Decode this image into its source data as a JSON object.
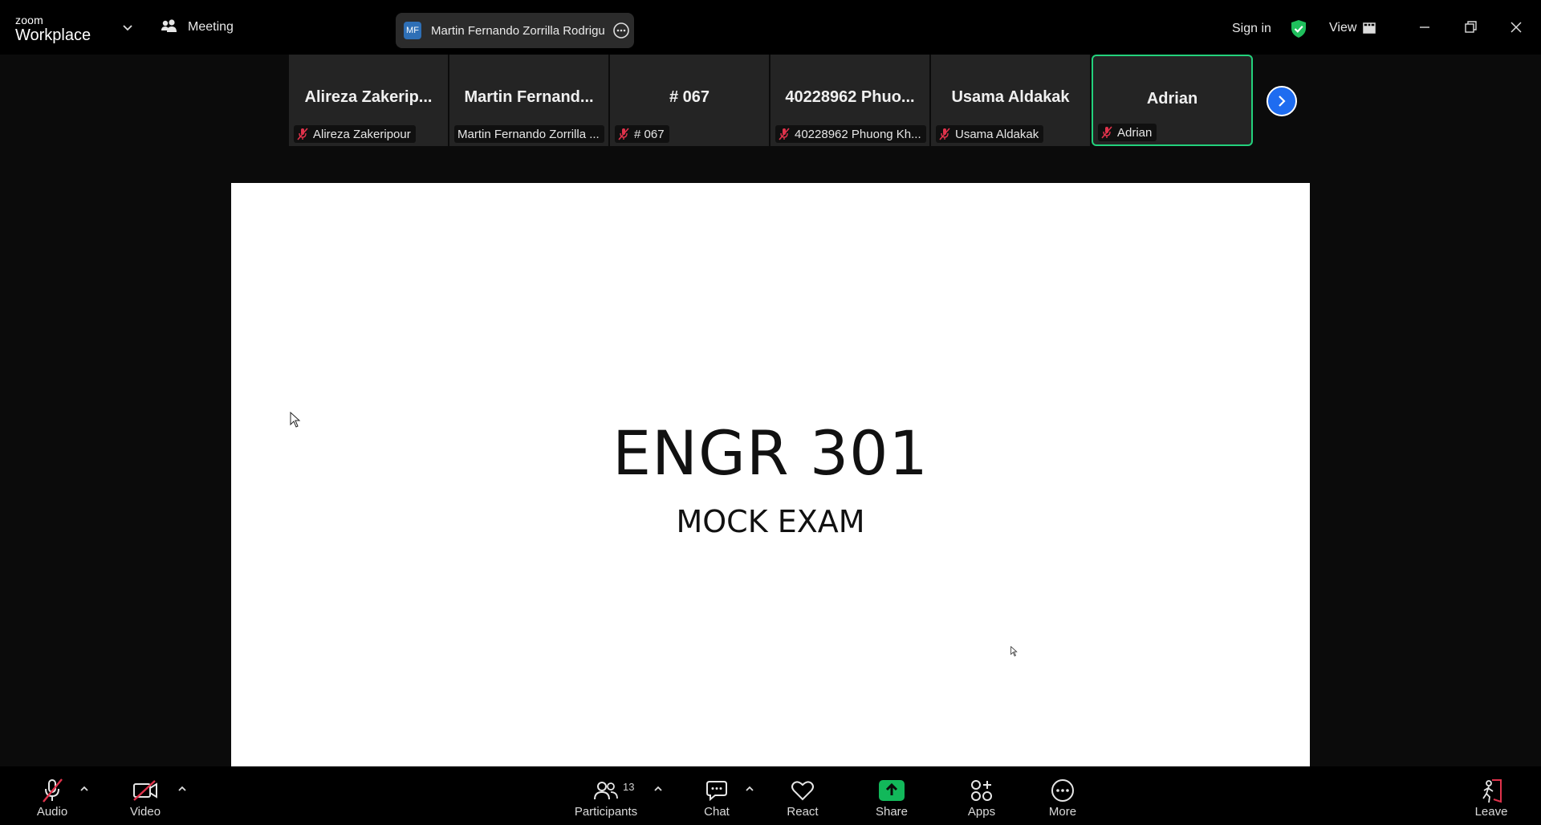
{
  "app": {
    "logo_small": "zoom",
    "logo_big": "Workplace"
  },
  "titlebar": {
    "meeting_label": "Meeting",
    "speaker_initials": "MF",
    "speaker_name": "Martin Fernando Zorrilla Rodrigu",
    "signin_label": "Sign in",
    "view_label": "View"
  },
  "participants_strip": [
    {
      "display_name": "Alireza  Zakerip...",
      "label": "Alireza Zakeripour",
      "muted": true
    },
    {
      "display_name": "Martin  Fernand...",
      "label": "Martin Fernando Zorrilla ...",
      "muted": false
    },
    {
      "display_name": "# 067",
      "label": "# 067",
      "muted": true
    },
    {
      "display_name": "40228962  Phuo...",
      "label": "40228962 Phuong Kh...",
      "muted": true
    },
    {
      "display_name": "Usama Aldakak",
      "label": "Usama Aldakak",
      "muted": true
    },
    {
      "display_name": "Adrian",
      "label": "Adrian",
      "muted": true,
      "active": true
    }
  ],
  "shared_screen": {
    "title": "ENGR 301",
    "subtitle": "MOCK EXAM"
  },
  "toolbar": {
    "audio_label": "Audio",
    "video_label": "Video",
    "participants_label": "Participants",
    "participants_count": "13",
    "chat_label": "Chat",
    "react_label": "React",
    "share_label": "Share",
    "apps_label": "Apps",
    "more_label": "More",
    "leave_label": "Leave"
  },
  "colors": {
    "active_border": "#23d17c",
    "share_green": "#12b85a",
    "muted_red": "#e0324b",
    "next_blue": "#1e6cf0"
  }
}
